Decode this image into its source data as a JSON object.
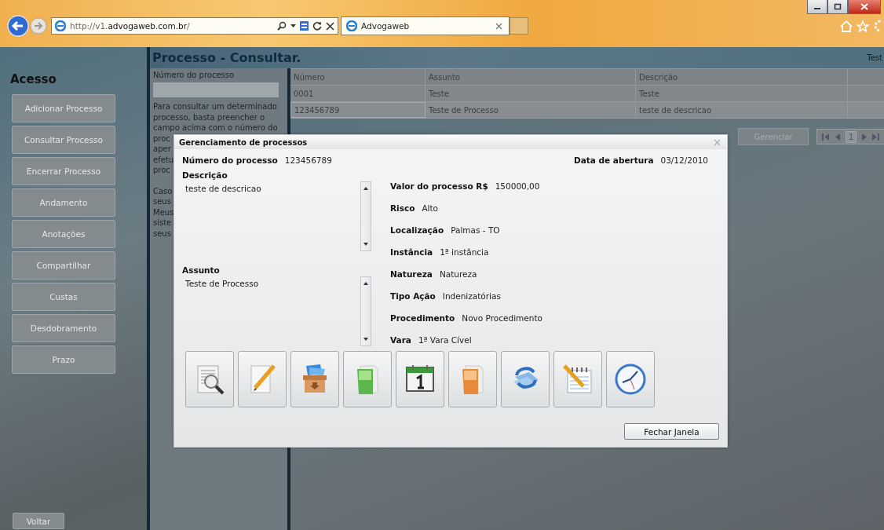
{
  "browser": {
    "address": "http://v1.**advogaweb.com.br**/",
    "tab_title": "Advogaweb"
  },
  "sidebar": {
    "title": "Acesso",
    "items": [
      "Adicionar Processo",
      "Consultar Processo",
      "Encerrar Processo",
      "Andamento",
      "Anotações",
      "Compartilhar",
      "Custas",
      "Desdobramento",
      "Prazo"
    ],
    "back_button": "Voltar"
  },
  "page": {
    "title": "Processo - Consultar.",
    "user": "Test",
    "search_label": "Número do processo",
    "help_lines": [
      "Para consultar um determinado",
      "processo, basta preencher o",
      "campo acima com o número do",
      "proc",
      "aper",
      "efetu",
      "proc"
    ],
    "help_lines_2": [
      "Caso",
      "seus",
      "Meus",
      "siste",
      "seus"
    ]
  },
  "table": {
    "columns": [
      "Número",
      "Assunto",
      "Descrição"
    ],
    "rows": [
      {
        "cells": [
          "0001",
          "Teste",
          "Teste"
        ],
        "selected": false
      },
      {
        "cells": [
          "123456789",
          "Teste de Processo",
          "teste de descricao"
        ],
        "selected": true
      }
    ]
  },
  "manage_button": "Gerenciar",
  "pager": {
    "page": "1"
  },
  "dialog": {
    "title": "Gerenciamento de processos",
    "number": {
      "label": "Número do processo",
      "value": "123456789"
    },
    "opened": {
      "label": "Data de abertura",
      "value": "03/12/2010"
    },
    "description": {
      "label": "Descrição",
      "value": "teste de descricao"
    },
    "subject": {
      "label": "Assunto",
      "value": "Teste de Processo"
    },
    "fields": [
      {
        "label": "Valor do processo R$",
        "value": "150000,00"
      },
      {
        "label": "Risco",
        "value": "Alto"
      },
      {
        "label": "Localização",
        "value": "Palmas - TO"
      },
      {
        "label": "Instância",
        "value": "1ª instância"
      },
      {
        "label": "Natureza",
        "value": "Natureza"
      },
      {
        "label": "Tipo Ação",
        "value": "Indenizatórias"
      },
      {
        "label": "Procedimento",
        "value": "Novo Procedimento"
      },
      {
        "label": "Vara",
        "value": "1ª Vara Cível"
      }
    ],
    "close_button": "Fechar Janela"
  }
}
